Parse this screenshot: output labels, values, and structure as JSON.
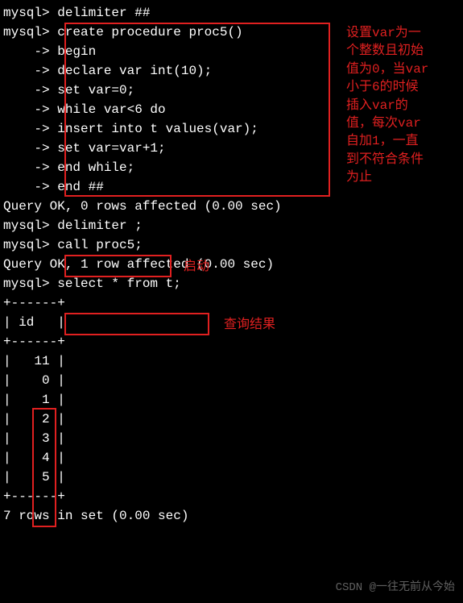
{
  "lines": {
    "l1": "mysql> delimiter ##",
    "l2": "mysql> create procedure proc5()",
    "l3": "    -> begin",
    "l4": "    -> declare var int(10);",
    "l5": "    -> set var=0;",
    "l6": "    -> while var<6 do",
    "l7": "    -> insert into t values(var);",
    "l8": "    -> set var=var+1;",
    "l9": "    -> end while;",
    "l10": "    -> end ##",
    "l11": "Query OK, 0 rows affected (0.00 sec)",
    "l12": "",
    "l13": "mysql> delimiter ;",
    "l14": "mysql> call proc5;",
    "l15": "Query OK, 1 row affected (0.00 sec)",
    "l16": "",
    "l17": "mysql> select * from t;",
    "l18": "+------+",
    "l19": "| id   |",
    "l20": "+------+",
    "l21": "|   11 |",
    "l22": "|    0 |",
    "l23": "|    1 |",
    "l24": "|    2 |",
    "l25": "|    3 |",
    "l26": "|    4 |",
    "l27": "|    5 |",
    "l28": "+------+",
    "l29": "7 rows in set (0.00 sec)"
  },
  "annotations": {
    "a1": "设置var为一\n个整数且初始\n值为0，当var\n小于6的时候\n插入var的\n值，每次var\n自加1，一直\n到不符合条件\n为止",
    "a2": "启动",
    "a3": "查询结果"
  },
  "watermark": "CSDN @一往无前从今始"
}
